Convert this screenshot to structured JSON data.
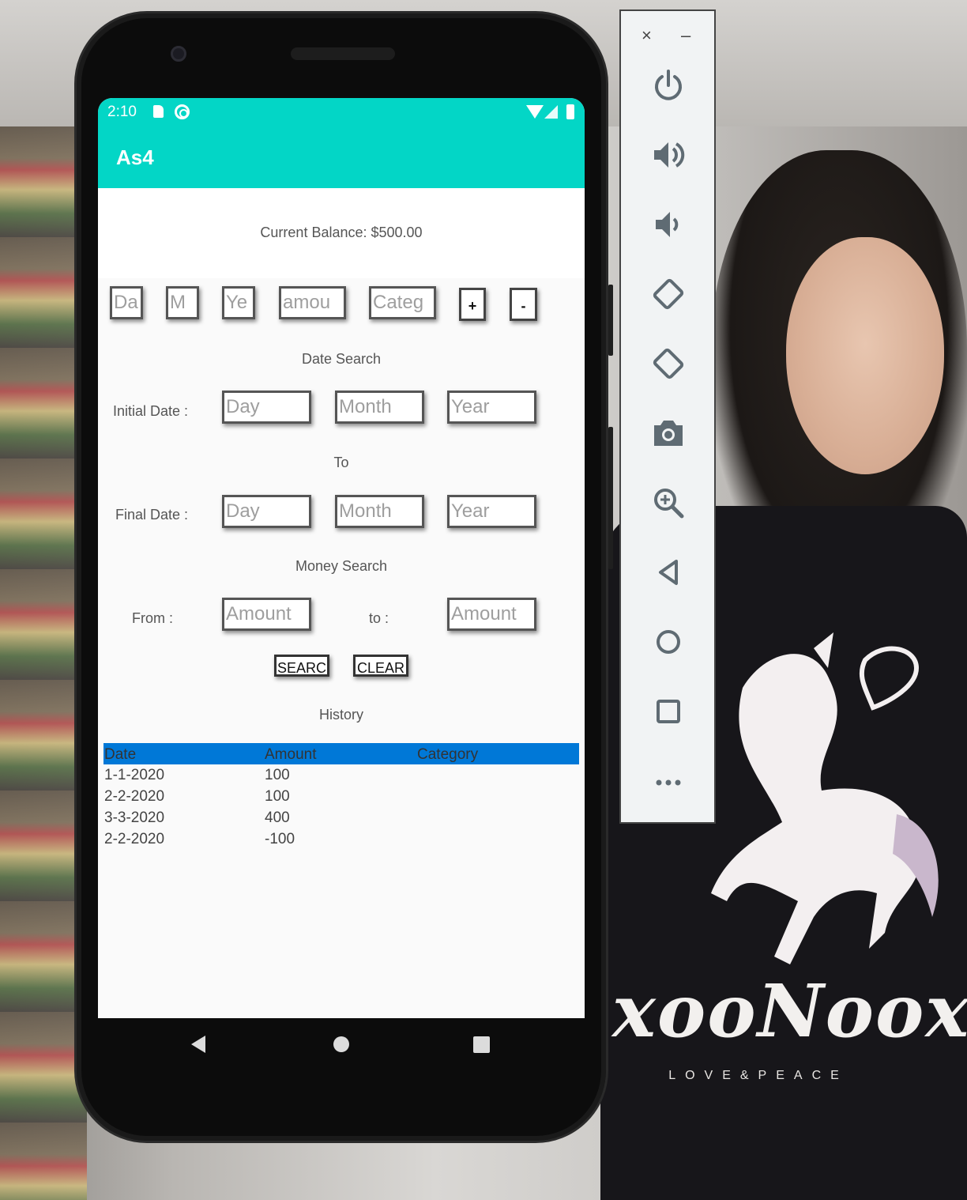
{
  "status_bar": {
    "time": "2:10"
  },
  "app_bar": {
    "title": "As4"
  },
  "balance": {
    "text": "Current Balance: $500.00"
  },
  "entry_row": {
    "day_placeholder": "Da",
    "month_placeholder": "M",
    "year_placeholder": "Ye",
    "amount_placeholder": "amou",
    "category_placeholder": "Categ",
    "add_label": "+",
    "subtract_label": "-"
  },
  "date_search": {
    "heading": "Date Search",
    "initial_label": "Initial Date :",
    "to_label": "To",
    "final_label": "Final Date :",
    "day_placeholder": "Day",
    "month_placeholder": "Month",
    "year_placeholder": "Year"
  },
  "money_search": {
    "heading": "Money Search",
    "from_label": "From :",
    "to_label": "to :",
    "amount_placeholder": "Amount"
  },
  "actions": {
    "search_label": "SEARC",
    "clear_label": "CLEAR"
  },
  "history": {
    "heading": "History",
    "columns": [
      "Date",
      "Amount",
      "Category"
    ],
    "rows": [
      {
        "date": "1-1-2020",
        "amount": "100",
        "category": ""
      },
      {
        "date": "2-2-2020",
        "amount": "100",
        "category": ""
      },
      {
        "date": "3-3-2020",
        "amount": "400",
        "category": ""
      },
      {
        "date": "2-2-2020",
        "amount": "-100",
        "category": ""
      }
    ]
  },
  "emulator_toolbar": {
    "close_glyph": "×",
    "minimize_glyph": "–",
    "items": [
      "power-icon",
      "volume-up-icon",
      "volume-down-icon",
      "rotate-left-icon",
      "rotate-right-icon",
      "camera-icon",
      "zoom-icon",
      "back-icon",
      "home-icon",
      "overview-icon",
      "more-icon"
    ]
  },
  "background": {
    "shirt_text": "xooNoox",
    "shirt_subtext": "LOVE&PEACE"
  },
  "colors": {
    "accent": "#03d6c6",
    "table_header": "#0078d7",
    "screen_bg": "#fafafa"
  }
}
